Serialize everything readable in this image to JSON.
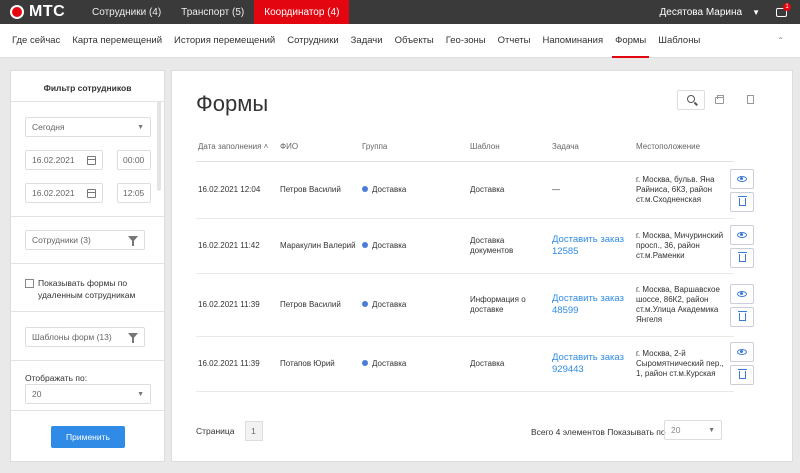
{
  "topbar": {
    "logo": "МТС",
    "tabs": [
      {
        "label": "Сотрудники (4)"
      },
      {
        "label": "Транспорт (5)"
      },
      {
        "label": "Координатор (4)"
      }
    ],
    "user": "Десятова Марина",
    "notifications": "1",
    "accent": "#e30611"
  },
  "nav": {
    "items": [
      "Где сейчас",
      "Карта перемещений",
      "История перемещений",
      "Сотрудники",
      "Задачи",
      "Объекты",
      "Гео-зоны",
      "Отчеты",
      "Напоминания",
      "Формы",
      "Шаблоны"
    ],
    "active": "Формы"
  },
  "filter": {
    "title": "Фильтр сотрудников",
    "period": "Сегодня",
    "date_from": "16.02.2021",
    "time_from": "00:00",
    "date_to": "16.02.2021",
    "time_to": "12:05",
    "employees": "Сотрудники (3)",
    "show_deleted": "Показывать формы по удаленным сотрудникам",
    "templates": "Шаблоны форм (13)",
    "show_label": "Отображать по:",
    "show_value": "20",
    "apply": "Применить"
  },
  "main": {
    "title": "Формы",
    "columns": {
      "date": "Дата заполнения",
      "fio": "ФИО",
      "group": "Группа",
      "template": "Шаблон",
      "task": "Задача",
      "location": "Местоположение"
    },
    "rows": [
      {
        "date": "16.02.2021 12:04",
        "fio": "Петров Василий",
        "group": "Доставка",
        "template": "Доставка",
        "task": "—",
        "task_link": false,
        "location": "г. Москва, бульв. Яна Райниса, 6К3, район ст.м.Сходненская"
      },
      {
        "date": "16.02.2021 11:42",
        "fio": "Маракулин Валерий",
        "group": "Доставка",
        "template": "Доставка документов",
        "task": "Доставить заказ 12585",
        "task_link": true,
        "location": "г. Москва, Мичуринский просп., 36, район ст.м.Раменки"
      },
      {
        "date": "16.02.2021 11:39",
        "fio": "Петров Василий",
        "group": "Доставка",
        "template": "Информация о доставке",
        "task": "Доставить заказ 48599",
        "task_link": true,
        "location": "г. Москва, Варшавское шоссе, 86К2, район ст.м.Улица Академика Янгеля"
      },
      {
        "date": "16.02.2021 11:39",
        "fio": "Потапов Юрий",
        "group": "Доставка",
        "template": "Доставка",
        "task": "Доставить заказ 929443",
        "task_link": true,
        "location": "г. Москва, 2-й Сыромятнический пер., 1, район ст.м.Курская"
      }
    ],
    "pagination": {
      "page_label": "Страница",
      "page": "1",
      "total": "Всего 4 элементов",
      "per_page_label": "Показывать по",
      "per_page": "20"
    }
  }
}
